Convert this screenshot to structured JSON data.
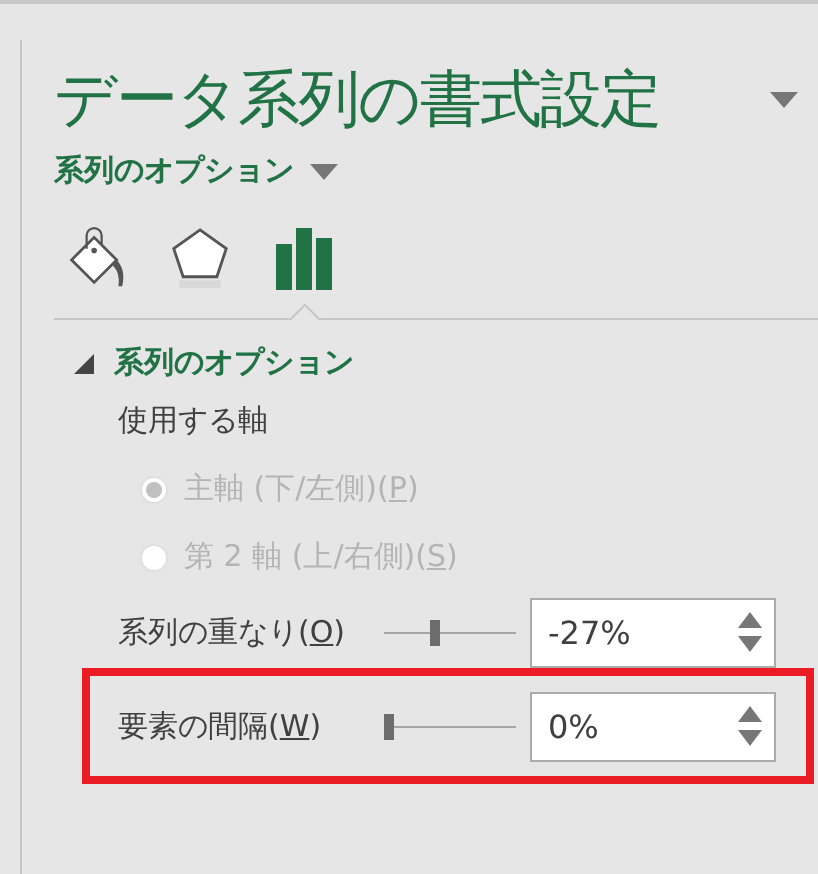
{
  "pane": {
    "title": "データ系列の書式設定",
    "options_menu": "系列のオプション"
  },
  "icon_tabs": [
    {
      "kind": "fill",
      "selected": false
    },
    {
      "kind": "effects",
      "selected": false
    },
    {
      "kind": "series",
      "selected": true
    }
  ],
  "section": {
    "title": "系列のオプション",
    "expanded": true,
    "axis_label": "使用する軸",
    "radios": [
      {
        "label": "主軸 (下/左側)(P)",
        "selected": true,
        "disabled": true
      },
      {
        "label": "第 2 軸 (上/右側)(S)",
        "selected": false,
        "disabled": true
      }
    ],
    "sliders": [
      {
        "label": "系列の重なり(O)",
        "level": 0.37,
        "value": "-27%",
        "highlighted": false
      },
      {
        "label": "要素の間隔(W)",
        "level": 0,
        "value": "0%",
        "highlighted": true
      }
    ]
  }
}
